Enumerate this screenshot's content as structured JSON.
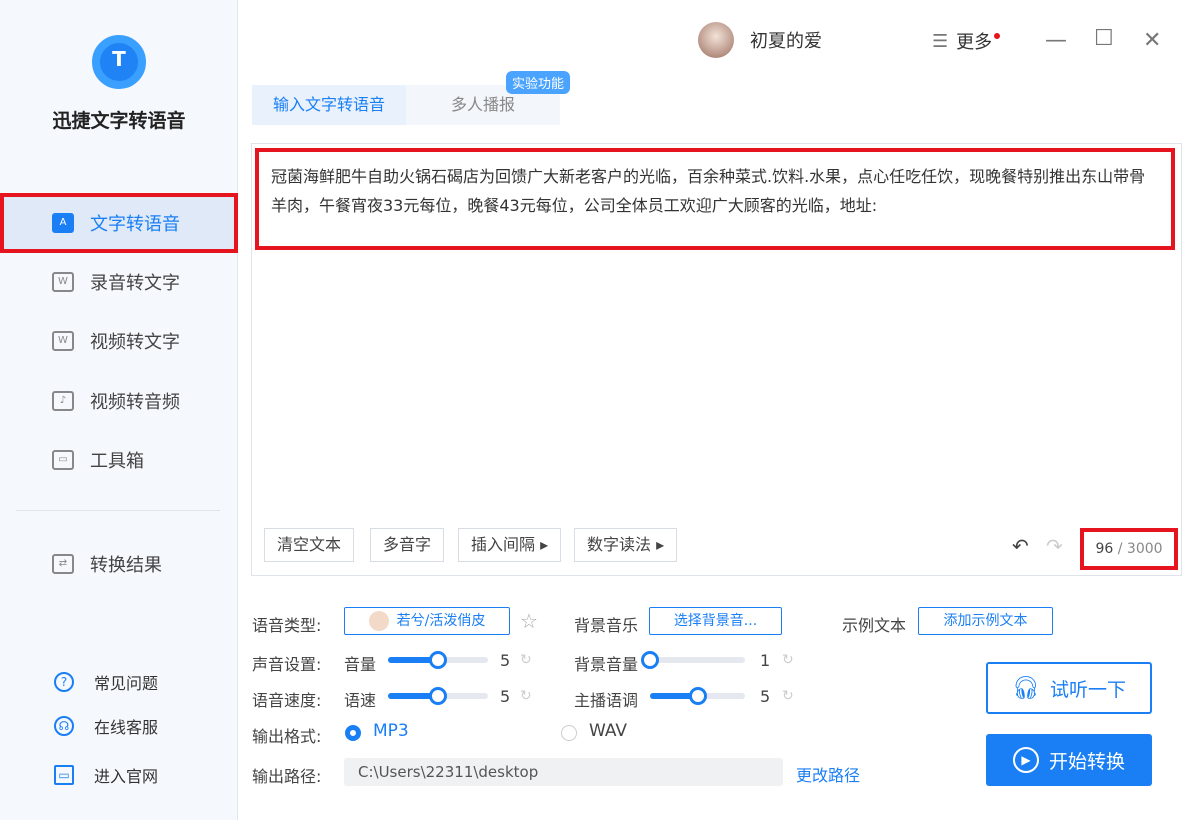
{
  "app": {
    "name": "迅捷文字转语音",
    "logo_letter": "T"
  },
  "sidebar": {
    "items": [
      {
        "label": "文字转语音",
        "icon": "A"
      },
      {
        "label": "录音转文字",
        "icon": "W"
      },
      {
        "label": "视频转文字",
        "icon": "W"
      },
      {
        "label": "视频转音频",
        "icon": "♪"
      },
      {
        "label": "工具箱",
        "icon": "▭"
      }
    ],
    "result": {
      "label": "转换结果",
      "icon": "⇄"
    },
    "help": [
      {
        "label": "常见问题",
        "icon": "?"
      },
      {
        "label": "在线客服",
        "icon": "☊"
      },
      {
        "label": "进入官网",
        "icon": "▭"
      }
    ]
  },
  "header": {
    "username": "初夏的爱",
    "more": "更多"
  },
  "tabs": [
    {
      "label": "输入文字转语音"
    },
    {
      "label": "多人播报"
    }
  ],
  "badge": "实验功能",
  "editor": {
    "text": "冠菌海鲜肥牛自助火锅石碣店为回馈广大新老客户的光临，百余种菜式.饮料.水果，点心任吃任饮，现晚餐特别推出东山带骨羊肉，午餐宵夜33元每位，晚餐43元每位，公司全体员工欢迎广大顾客的光临，地址:",
    "buttons": [
      "清空文本",
      "多音字",
      "插入间隔 ▸",
      "数字读法 ▸"
    ],
    "count": "96",
    "max": "3000"
  },
  "settings": {
    "voice_type_label": "语音类型:",
    "voice": "若兮/活泼俏皮",
    "bgm_label": "背景音乐",
    "bgm_button": "选择背景音...",
    "sample_label": "示例文本",
    "sample_button": "添加示例文本",
    "sound_label": "声音设置:",
    "volume_label": "音量",
    "volume": 5,
    "volume_pct": 50,
    "bg_volume_label": "背景音量",
    "bg_volume": 1,
    "bg_volume_pct": 0,
    "speed_row_label": "语音速度:",
    "speed_label": "语速",
    "speed": 5,
    "speed_pct": 50,
    "pitch_label": "主播语调",
    "pitch": 5,
    "pitch_pct": 50,
    "format_label": "输出格式:",
    "formats": [
      "MP3",
      "WAV"
    ],
    "selected_format": "MP3",
    "path_label": "输出路径:",
    "path": "C:\\Users\\22311\\desktop",
    "change_path": "更改路径"
  },
  "actions": {
    "preview": "试听一下",
    "start": "开始转换"
  },
  "colors": {
    "accent": "#1a7ff5",
    "highlight": "#e5141e"
  }
}
